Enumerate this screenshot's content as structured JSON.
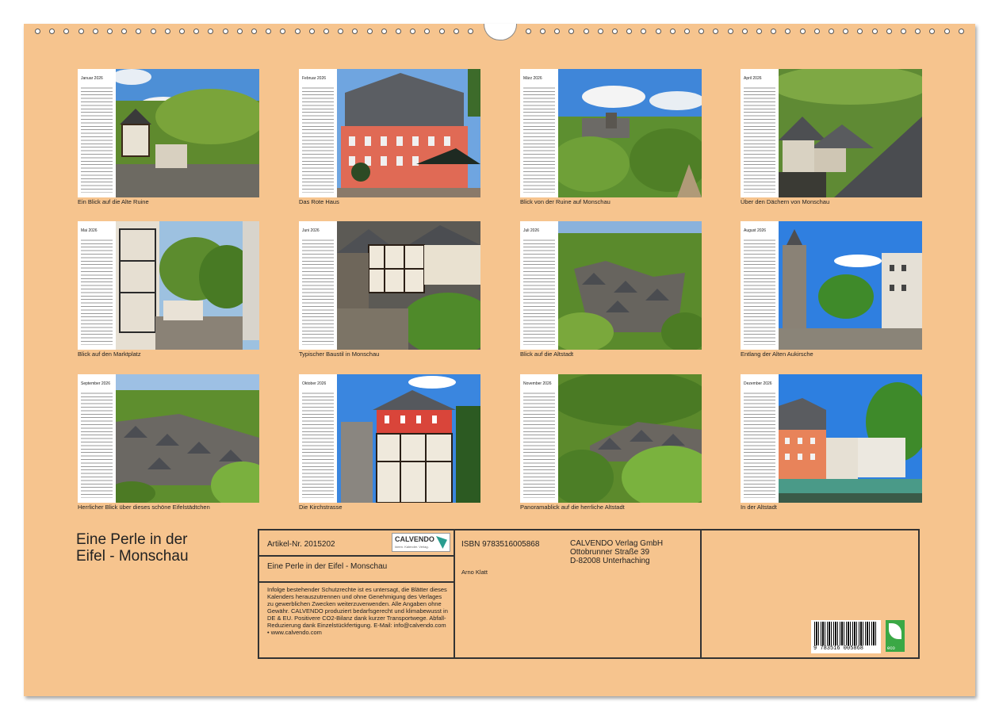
{
  "months": [
    {
      "name": "Januar 2026",
      "caption": "Ein Blick auf die Alte Ruine"
    },
    {
      "name": "Februar 2026",
      "caption": "Das Rote Haus"
    },
    {
      "name": "März 2026",
      "caption": "Blick von der Ruine auf Monschau"
    },
    {
      "name": "April 2026",
      "caption": "Über den Dächern von Monschau"
    },
    {
      "name": "Mai 2026",
      "caption": "Blick auf den Marktplatz"
    },
    {
      "name": "Juni 2026",
      "caption": "Typischer Baustil in Monschau"
    },
    {
      "name": "Juli 2026",
      "caption": "Blick auf die Altstadt"
    },
    {
      "name": "August 2026",
      "caption": "Entlang der Alten Aukirsche"
    },
    {
      "name": "September 2026",
      "caption": "Herrlicher Blick über dieses schöne Eifelstädtchen"
    },
    {
      "name": "Oktober 2026",
      "caption": "Die Kirchstrasse"
    },
    {
      "name": "November 2026",
      "caption": "Panoramablick auf die herrliche Altstadt"
    },
    {
      "name": "Dezember 2026",
      "caption": "In der Altstadt"
    }
  ],
  "calendar_title": {
    "line1": "Eine Perle in der",
    "line2": "Eifel - Monschau"
  },
  "info": {
    "article": "Artikel-Nr. 2015202",
    "logo_text": "CALVENDO",
    "logo_sub": "Ideen. Kalender. Verlag.",
    "subtitle": "Eine Perle in der Eifel - Monschau",
    "legal": "Infolge bestehender Schutzrechte ist es untersagt, die Blätter dieses Kalenders herauszutrennen und ohne Genehmigung des Verlages zu gewerblichen Zwecken weiterzuverwenden. Alle Angaben ohne Gewähr. CALVENDO produziert bedarfsgerecht und klimabewusst in DE & EU. Positivere CO2-Bilanz dank kurzer Transportwege. Abfall-Reduzierung dank Einzelstückfertigung. E-Mail: info@calvendo.com • www.calvendo.com",
    "isbn": "ISBN 9783516005868",
    "author": "Arno Klatt",
    "publisher_line1": "CALVENDO Verlag GmbH",
    "publisher_line2": "Ottobrunner Straße 39",
    "publisher_line3": "D-82008 Unterhaching",
    "barcode_number": "9 783516 005868",
    "eco_label": "eco"
  },
  "colors": {
    "sheet": "#f6c48e",
    "frame": "#333333"
  }
}
